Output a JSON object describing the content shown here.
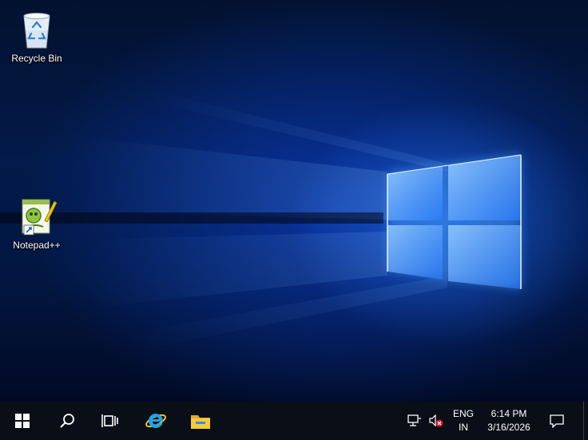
{
  "desktop": {
    "icons": [
      {
        "label": "Recycle Bin",
        "icon": "recycle-bin-icon"
      },
      {
        "label": "Notepad++",
        "icon": "notepad-plus-plus-icon"
      }
    ]
  },
  "taskbar": {
    "pinned": [
      {
        "icon": "windows-start-icon"
      },
      {
        "icon": "search-icon"
      },
      {
        "icon": "task-view-icon"
      },
      {
        "icon": "internet-explorer-icon"
      },
      {
        "icon": "file-explorer-icon"
      }
    ],
    "tray": {
      "network_icon": "network-icon",
      "volume_icon": "volume-muted-icon",
      "lang_top": "ENG",
      "lang_bottom": "IN",
      "time": "6:14 PM",
      "date": "3/16/2026",
      "notification_icon": "action-center-icon"
    }
  },
  "colors": {
    "taskbar_bg": "#0a0f17",
    "wallpaper_glow": "#3b8cff",
    "wallpaper_dark": "#021640",
    "mute_badge": "#e81123",
    "folder_yellow": "#f8c93c",
    "ie_blue": "#1ea4e9"
  }
}
